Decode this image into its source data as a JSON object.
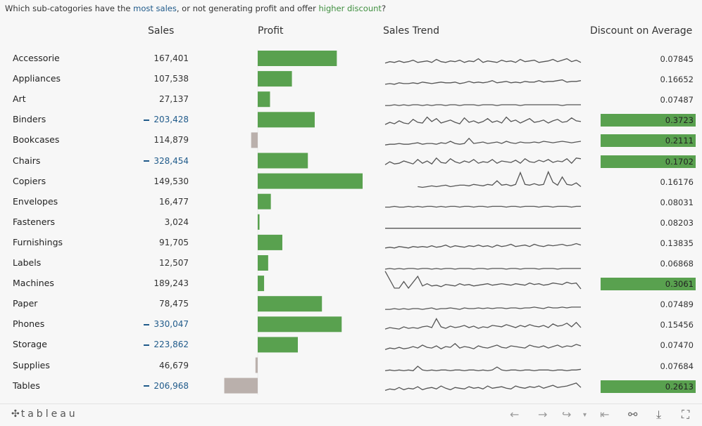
{
  "title": {
    "prefix": "Which sub-catogories have the ",
    "sales_highlight": "most sales",
    "middle": ", or not generating profit and offer ",
    "discount_highlight": "higher discount",
    "suffix": "?"
  },
  "headers": {
    "sales": "Sales",
    "profit": "Profit",
    "trend": "Sales Trend",
    "discount": "Discount on Average"
  },
  "colors": {
    "profit_positive": "#59a14f",
    "profit_negative": "#bab0ac",
    "high_discount": "#59a14f",
    "sales_highlight": "#1f5a8a",
    "trend_line": "#555555"
  },
  "chart_data": {
    "type": "table",
    "categories": [
      "Accessorie",
      "Appliances",
      "Art",
      "Binders",
      "Bookcases",
      "Chairs",
      "Copiers",
      "Envelopes",
      "Fasteners",
      "Furnishings",
      "Labels",
      "Machines",
      "Paper",
      "Phones",
      "Storage",
      "Supplies",
      "Tables"
    ],
    "sales_labels": [
      "167,401",
      "107,538",
      "27,137",
      "203,428",
      "114,879",
      "328,454",
      "149,530",
      "16,477",
      "3,024",
      "91,705",
      "12,507",
      "189,243",
      "78,475",
      "330,047",
      "223,862",
      "46,679",
      "206,968"
    ],
    "sales_highlight": [
      false,
      false,
      false,
      true,
      false,
      true,
      false,
      false,
      false,
      false,
      false,
      false,
      false,
      true,
      true,
      false,
      true
    ],
    "profit": [
      41937,
      18138,
      6528,
      30222,
      -3473,
      26590,
      55618,
      6964,
      950,
      13059,
      5546,
      3385,
      34054,
      44516,
      21279,
      -1189,
      -17725
    ],
    "discount_labels": [
      "0.07845",
      "0.16652",
      "0.07487",
      "0.3723",
      "0.2111",
      "0.1702",
      "0.16176",
      "0.08031",
      "0.08203",
      "0.13835",
      "0.06868",
      "0.3061",
      "0.07489",
      "0.15456",
      "0.07470",
      "0.07684",
      "0.2613"
    ],
    "discount_highlight": [
      false,
      false,
      false,
      true,
      true,
      true,
      false,
      false,
      false,
      false,
      false,
      true,
      false,
      false,
      false,
      false,
      true
    ],
    "trend": [
      [
        4,
        6,
        5,
        7,
        5,
        6,
        8,
        5,
        6,
        7,
        5,
        9,
        6,
        5,
        7,
        6,
        8,
        5,
        7,
        6,
        10,
        5,
        7,
        6,
        5,
        8,
        6,
        7,
        5,
        9,
        6,
        7,
        8,
        5,
        6,
        7,
        9,
        6,
        8,
        10,
        6,
        8,
        5
      ],
      [
        3,
        4,
        3,
        5,
        4,
        4,
        5,
        4,
        6,
        5,
        4,
        5,
        6,
        5,
        5,
        6,
        4,
        5,
        7,
        5,
        6,
        5,
        6,
        8,
        5,
        6,
        7,
        5,
        6,
        5,
        7,
        6,
        6,
        8,
        6,
        7,
        7,
        8,
        9,
        6,
        7,
        7,
        8
      ],
      [
        2,
        2,
        3,
        2,
        3,
        2,
        3,
        3,
        2,
        3,
        2,
        3,
        3,
        2,
        3,
        3,
        2,
        3,
        3,
        3,
        2,
        3,
        3,
        3,
        2,
        3,
        3,
        3,
        3,
        2,
        3,
        3,
        3,
        3,
        3,
        3,
        3,
        3,
        2,
        3,
        3,
        3,
        3
      ],
      [
        4,
        7,
        5,
        9,
        6,
        5,
        11,
        7,
        6,
        14,
        8,
        12,
        6,
        8,
        10,
        7,
        5,
        13,
        7,
        9,
        6,
        8,
        12,
        7,
        9,
        6,
        14,
        8,
        10,
        6,
        9,
        12,
        7,
        8,
        10,
        6,
        9,
        11,
        7,
        8,
        13,
        9,
        8
      ],
      [
        4,
        5,
        5,
        6,
        5,
        5,
        6,
        7,
        5,
        6,
        6,
        5,
        7,
        6,
        9,
        6,
        5,
        6,
        13,
        6,
        7,
        8,
        6,
        7,
        8,
        6,
        9,
        7,
        6,
        8,
        7,
        7,
        8,
        7,
        9,
        8,
        7,
        8,
        9,
        8,
        7,
        8,
        9
      ],
      [
        5,
        9,
        6,
        7,
        10,
        8,
        6,
        12,
        7,
        10,
        6,
        14,
        8,
        7,
        13,
        9,
        7,
        10,
        8,
        12,
        7,
        9,
        8,
        12,
        7,
        10,
        9,
        8,
        11,
        7,
        13,
        9,
        8,
        11,
        9,
        12,
        8,
        10,
        9,
        13,
        7,
        14,
        13
      ],
      [
        null,
        null,
        null,
        null,
        null,
        null,
        null,
        3,
        2,
        3,
        4,
        3,
        4,
        5,
        3,
        4,
        5,
        5,
        4,
        6,
        5,
        4,
        6,
        5,
        11,
        5,
        6,
        4,
        6,
        22,
        6,
        5,
        7,
        5,
        6,
        23,
        9,
        5,
        16,
        6,
        5,
        8,
        3
      ],
      [
        3,
        3,
        4,
        3,
        3,
        4,
        3,
        4,
        3,
        4,
        4,
        3,
        4,
        3,
        4,
        4,
        3,
        4,
        4,
        3,
        4,
        4,
        3,
        4,
        4,
        4,
        3,
        4,
        4,
        3,
        4,
        4,
        4,
        3,
        4,
        4,
        3,
        4,
        4,
        4,
        3,
        4,
        4
      ],
      [
        2,
        2,
        2,
        2,
        2,
        2,
        2,
        2,
        2,
        2,
        2,
        2,
        2,
        2,
        2,
        2,
        2,
        2,
        2,
        2,
        2,
        2,
        2,
        2,
        2,
        2,
        2,
        2,
        2,
        2,
        2,
        2,
        2,
        2,
        2,
        2,
        2,
        2,
        2,
        2,
        2,
        2,
        2
      ],
      [
        3,
        4,
        3,
        5,
        4,
        3,
        5,
        4,
        5,
        4,
        6,
        4,
        5,
        7,
        4,
        6,
        5,
        4,
        6,
        5,
        7,
        5,
        6,
        4,
        7,
        5,
        6,
        8,
        5,
        6,
        7,
        5,
        8,
        6,
        5,
        7,
        6,
        7,
        8,
        6,
        7,
        9,
        7
      ],
      [
        2,
        3,
        2,
        3,
        2,
        3,
        3,
        2,
        3,
        3,
        2,
        3,
        2,
        3,
        3,
        2,
        3,
        3,
        3,
        2,
        3,
        3,
        2,
        3,
        3,
        3,
        2,
        3,
        3,
        2,
        3,
        3,
        3,
        2,
        3,
        3,
        3,
        2,
        3,
        3,
        3,
        3,
        3
      ],
      [
        27,
        null,
        4,
        4,
        13,
        4,
        null,
        20,
        7,
        10,
        7,
        8,
        6,
        9,
        8,
        7,
        10,
        8,
        9,
        7,
        8,
        9,
        10,
        8,
        9,
        10,
        9,
        8,
        10,
        9,
        8,
        11,
        9,
        10,
        8,
        9,
        11,
        10,
        9,
        12,
        10,
        11,
        3
      ],
      [
        3,
        3,
        4,
        3,
        4,
        3,
        4,
        4,
        3,
        4,
        5,
        3,
        4,
        4,
        5,
        4,
        3,
        5,
        4,
        4,
        5,
        4,
        5,
        4,
        5,
        5,
        4,
        5,
        5,
        4,
        5,
        5,
        6,
        5,
        4,
        6,
        5,
        5,
        6,
        5,
        6,
        6,
        6
      ],
      [
        4,
        6,
        5,
        4,
        7,
        5,
        6,
        5,
        7,
        8,
        6,
        18,
        7,
        5,
        8,
        6,
        7,
        9,
        6,
        8,
        5,
        7,
        6,
        9,
        8,
        7,
        10,
        8,
        6,
        9,
        7,
        10,
        8,
        7,
        9,
        6,
        11,
        8,
        9,
        12,
        7,
        13,
        6
      ],
      [
        4,
        6,
        5,
        7,
        5,
        6,
        8,
        6,
        10,
        7,
        6,
        9,
        5,
        8,
        7,
        12,
        6,
        8,
        7,
        5,
        9,
        7,
        6,
        8,
        10,
        7,
        6,
        9,
        8,
        7,
        6,
        10,
        8,
        7,
        9,
        6,
        8,
        10,
        7,
        9,
        8,
        11,
        9
      ],
      [
        3,
        4,
        3,
        4,
        3,
        4,
        3,
        9,
        4,
        3,
        4,
        3,
        4,
        4,
        3,
        4,
        4,
        3,
        4,
        4,
        3,
        4,
        3,
        4,
        8,
        4,
        3,
        4,
        4,
        3,
        4,
        4,
        3,
        4,
        4,
        4,
        3,
        4,
        4,
        3,
        4,
        4,
        5
      ],
      [
        4,
        6,
        5,
        8,
        5,
        7,
        6,
        9,
        5,
        7,
        8,
        6,
        10,
        7,
        5,
        8,
        7,
        6,
        9,
        7,
        8,
        6,
        10,
        7,
        8,
        9,
        7,
        6,
        10,
        8,
        7,
        9,
        8,
        10,
        7,
        9,
        11,
        8,
        9,
        10,
        12,
        14,
        8
      ]
    ]
  },
  "footer": {
    "logo": "tableau",
    "logo_icon": "tableau-cross-icon",
    "toolbar_icons": [
      "undo-icon",
      "redo-icon",
      "revert-icon",
      "revert-dropdown-icon",
      "reset-icon",
      "share-icon",
      "download-icon",
      "fullscreen-icon"
    ]
  }
}
